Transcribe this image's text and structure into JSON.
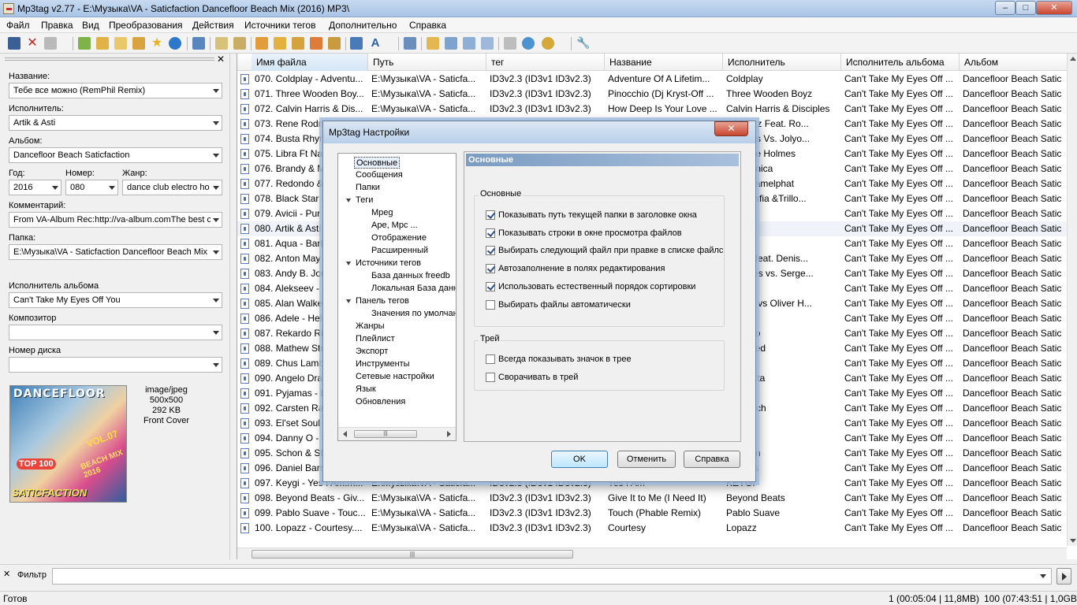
{
  "window": {
    "title": "Mp3tag v2.77  -  E:\\Музыка\\VA - Saticfaction Dancefloor Beach Mix (2016) MP3\\"
  },
  "menu": [
    "Файл",
    "Правка",
    "Вид",
    "Преобразования",
    "Действия",
    "Источники тегов",
    "Дополнительно",
    "Справка"
  ],
  "tag_panel": {
    "title_label": "Название:",
    "title_value": "Тебе все можно (RemPhil Remix)",
    "artist_label": "Исполнитель:",
    "artist_value": "Artik & Asti",
    "album_label": "Альбом:",
    "album_value": "Dancefloor Beach Saticfaction",
    "year_label": "Год:",
    "year_value": "2016",
    "track_label": "Номер:",
    "track_value": "080",
    "genre_label": "Жанр:",
    "genre_value": "dance club electro ho",
    "comment_label": "Комментарий:",
    "comment_value": "From VA-Album Rec:http://va-album.comThe best c",
    "folder_label": "Папка:",
    "folder_value": "E:\\Музыка\\VA - Saticfaction Dancefloor Beach Mix",
    "album_artist_label": "Исполнитель альбома",
    "album_artist_value": "Can't Take My Eyes Off You",
    "composer_label": "Композитор",
    "composer_value": "",
    "disc_label": "Номер диска",
    "disc_value": "",
    "cover": {
      "mime": "image/jpeg",
      "dims": "500x500",
      "size": "292 KB",
      "type": "Front Cover",
      "art_text": [
        "DANCEFLOOR",
        "TOP 100",
        "SATICFACTION",
        "VOL.07",
        "BEACH MIX 2016"
      ]
    }
  },
  "file_list": {
    "columns": [
      "Имя файла",
      "Путь",
      "тег",
      "Название",
      "Исполнитель",
      "Исполнитель альбома",
      "Альбом"
    ],
    "rows": [
      [
        "070. Coldplay - Adventu...",
        "E:\\Музыка\\VA - Saticfa...",
        "ID3v2.3 (ID3v1 ID3v2.3)",
        "Adventure Of A Lifetim...",
        "Coldplay",
        "Can't Take My Eyes Off ...",
        "Dancefloor Beach Satic"
      ],
      [
        "071. Three Wooden Boy...",
        "E:\\Музыка\\VA - Saticfa...",
        "ID3v2.3 (ID3v1 ID3v2.3)",
        "Pinocchio (Dj Kryst-Off ...",
        "Three Wooden Boyz",
        "Can't Take My Eyes Off ...",
        "Dancefloor Beach Satic"
      ],
      [
        "072. Calvin Harris & Dis...",
        "E:\\Музыка\\VA - Saticfa...",
        "ID3v2.3 (ID3v1 ID3v2.3)",
        "How Deep Is Your Love ...",
        "Calvin Harris & Disciples",
        "Can't Take My Eyes Off ...",
        "Dancefloor Beach Satic"
      ],
      [
        "073. Rene Rodrig",
        "",
        "",
        "",
        "odrigezz Feat. Ro...",
        "Can't Take My Eyes Off ...",
        "Dancefloor Beach Satic"
      ],
      [
        "074. Busta Rhym",
        "",
        "",
        "",
        "Rhymes Vs. Jolyo...",
        "Can't Take My Eyes Off ...",
        "Dancefloor Beach Satic"
      ],
      [
        "075. Libra Ft Nat",
        "",
        "",
        "",
        "t Natalie Holmes",
        "Can't Take My Eyes Off ...",
        "Dancefloor Beach Satic"
      ],
      [
        "076. Brandy & M",
        "",
        "",
        "",
        "y & Monica",
        "Can't Take My Eyes Off ...",
        "Dancefloor Beach Satic"
      ],
      [
        "077. Redondo &",
        "",
        "",
        "",
        "do & Camelphat",
        "Can't Take My Eyes Off ...",
        "Dancefloor Beach Satic"
      ],
      [
        "078. Black Star M",
        "",
        "",
        "",
        "Star Mafia &Trillo...",
        "Can't Take My Eyes Off ...",
        "Dancefloor Beach Satic"
      ],
      [
        "079. Avicii - Pur",
        "",
        "",
        "",
        "",
        "Can't Take My Eyes Off ...",
        "Dancefloor Beach Satic"
      ],
      [
        "080. Artik & Asti",
        "",
        "",
        "",
        "& Asti",
        "Can't Take My Eyes Off ...",
        "Dancefloor Beach Satic"
      ],
      [
        "081. Aqua - Barb",
        "",
        "",
        "",
        "",
        "Can't Take My Eyes Off ...",
        "Dancefloor Beach Satic"
      ],
      [
        "082. Anton May",
        "",
        "",
        "",
        "Mayer feat. Denis...",
        "Can't Take My Eyes Off ...",
        "Dancefloor Beach Satic"
      ],
      [
        "083. Andy B. Jon",
        "",
        "",
        "",
        "B. Jones vs. Serge...",
        "Can't Take My Eyes Off ...",
        "Dancefloor Beach Satic"
      ],
      [
        "084. Alekseev -",
        "",
        "",
        "",
        "ev",
        "Can't Take My Eyes Off ...",
        "Dancefloor Beach Satic"
      ],
      [
        "085. Alan Walke",
        "",
        "",
        "",
        "Walker vs Oliver H...",
        "Can't Take My Eyes Off ...",
        "Dancefloor Beach Satic"
      ],
      [
        "086. Adele - Hel",
        "",
        "",
        "",
        "",
        "Can't Take My Eyes Off ...",
        "Dancefloor Beach Satic"
      ],
      [
        "087. Rekardo Riv",
        "",
        "",
        "",
        "o Rivalo",
        "Can't Take My Eyes Off ...",
        "Dancefloor Beach Satic"
      ],
      [
        "088. Mathew Sto",
        "",
        "",
        "",
        "w Stoned",
        "Can't Take My Eyes Off ...",
        "Dancefloor Beach Satic"
      ],
      [
        "089. Chus Lamb",
        "",
        "",
        "",
        "amboa",
        "Can't Take My Eyes Off ...",
        "Dancefloor Beach Satic"
      ],
      [
        "090. Angelo Dra",
        "",
        "",
        "",
        "o Draetta",
        "Can't Take My Eyes Off ...",
        "Dancefloor Beach Satic"
      ],
      [
        "091. Pyjamas - L",
        "",
        "",
        "",
        "as",
        "Can't Take My Eyes Off ...",
        "Dancefloor Beach Satic"
      ],
      [
        "092. Carsten Rau",
        "",
        "",
        "",
        "n Rausch",
        "Can't Take My Eyes Off ...",
        "Dancefloor Beach Satic"
      ],
      [
        "093. El'set Soul",
        "",
        "",
        "",
        "Soul",
        "Can't Take My Eyes Off ...",
        "Dancefloor Beach Satic"
      ],
      [
        "094. Danny O - S",
        "",
        "",
        "",
        "O",
        "Can't Take My Eyes Off ...",
        "Dancefloor Beach Satic"
      ],
      [
        "095. Schon & St",
        "",
        "",
        "",
        "& Sturm",
        "Can't Take My Eyes Off ...",
        "Dancefloor Beach Satic"
      ],
      [
        "096. Daniel Barr",
        "",
        "",
        "",
        "Barross",
        "Can't Take My Eyes Off ...",
        "Dancefloor Beach Satic"
      ],
      [
        "097. Keygi - Yes I Am.m...",
        "E:\\Музыка\\VA - Saticfa...",
        "ID3v2.3 (ID3v1 ID3v2.3)",
        "Yes I Am",
        "KEYGI",
        "Can't Take My Eyes Off ...",
        "Dancefloor Beach Satic"
      ],
      [
        "098. Beyond Beats - Giv...",
        "E:\\Музыка\\VA - Saticfa...",
        "ID3v2.3 (ID3v1 ID3v2.3)",
        "Give It to Me (I Need It)",
        "Beyond Beats",
        "Can't Take My Eyes Off ...",
        "Dancefloor Beach Satic"
      ],
      [
        "099. Pablo Suave - Touc...",
        "E:\\Музыка\\VA - Saticfa...",
        "ID3v2.3 (ID3v1 ID3v2.3)",
        "Touch (Phable Remix)",
        "Pablo Suave",
        "Can't Take My Eyes Off ...",
        "Dancefloor Beach Satic"
      ],
      [
        "100. Lopazz - Courtesy....",
        "E:\\Музыка\\VA - Saticfa...",
        "ID3v2.3 (ID3v1 ID3v2.3)",
        "Courtesy",
        "Lopazz",
        "Can't Take My Eyes Off ...",
        "Dancefloor Beach Satic"
      ]
    ]
  },
  "filter": {
    "label": "Фильтр",
    "value": ""
  },
  "status": {
    "left": "Готов",
    "selected": "1 (00:05:04 | 11,8MB)",
    "total": "100 (07:43:51 | 1,0GB)"
  },
  "dialog": {
    "title": "Mp3tag Настройки",
    "tree": [
      {
        "label": "Основные",
        "level": 0,
        "expander": false,
        "selected": true
      },
      {
        "label": "Сообщения",
        "level": 0
      },
      {
        "label": "Папки",
        "level": 0
      },
      {
        "label": "Теги",
        "level": 0,
        "expander": true
      },
      {
        "label": "Mpeg",
        "level": 1
      },
      {
        "label": "Ape, Mpc ...",
        "level": 1
      },
      {
        "label": "Отображение",
        "level": 1
      },
      {
        "label": "Расширенный",
        "level": 1
      },
      {
        "label": "Источники тегов",
        "level": 0,
        "expander": true
      },
      {
        "label": "База данных freedb",
        "level": 1
      },
      {
        "label": "Локальная База данн",
        "level": 1
      },
      {
        "label": "Панель тегов",
        "level": 0,
        "expander": true
      },
      {
        "label": "Значения по умолчан",
        "level": 1
      },
      {
        "label": "Жанры",
        "level": 0
      },
      {
        "label": "Плейлист",
        "level": 0
      },
      {
        "label": "Экспорт",
        "level": 0
      },
      {
        "label": "Инструменты",
        "level": 0
      },
      {
        "label": "Сетевые настройки",
        "level": 0
      },
      {
        "label": "Язык",
        "level": 0
      },
      {
        "label": "Обновления",
        "level": 0
      }
    ],
    "panel_header": "Основные",
    "group_main": {
      "label": "Основные",
      "options": [
        {
          "label": "Показывать путь текущей папки в заголовке окна",
          "checked": true
        },
        {
          "label": "Показывать строки в окне просмотра файлов",
          "checked": true
        },
        {
          "label": "Выбирать следующий файл при правке в списке файлс",
          "checked": true
        },
        {
          "label": "Автозаполнение в полях редактирования",
          "checked": true
        },
        {
          "label": "Использовать естественный порядок сортировки",
          "checked": true
        },
        {
          "label": "Выбирать файлы автоматически",
          "checked": false
        }
      ]
    },
    "group_tray": {
      "label": "Трей",
      "options": [
        {
          "label": "Всегда показывать значок в трее",
          "checked": false
        },
        {
          "label": "Сворачивать в трей",
          "checked": false
        }
      ]
    },
    "buttons": {
      "ok": "OK",
      "cancel": "Отменить",
      "help": "Справка"
    }
  },
  "colors": {
    "selection": "#f0f4fa",
    "dialog_header": "#7b9cc2",
    "accent": "#3c7fb1"
  }
}
